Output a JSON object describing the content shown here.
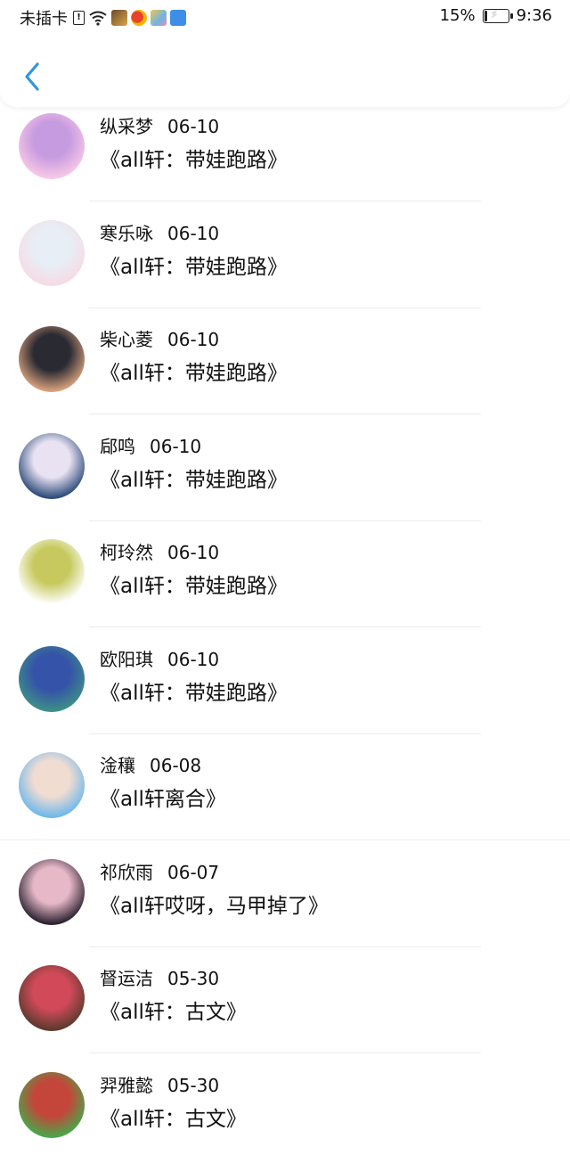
{
  "status_bar": {
    "carrier": "未插卡",
    "sim_badge": "!",
    "battery": "15%",
    "battery_level": 0.15,
    "time": "9:36",
    "icons": [
      "sim-alert-icon",
      "wifi-icon",
      "app-notification-icon",
      "weibo-icon",
      "app-notification-icon",
      "cloud-icon",
      "battery-charging-icon"
    ]
  },
  "header": {
    "back_icon": "chevron-left-icon",
    "accent": "#2f97d8"
  },
  "items": [
    {
      "name": "纵采梦",
      "date": "06-10",
      "title": "《all轩：带娃跑路》",
      "avatar_colors": [
        "#f7c8e6",
        "#c79be0"
      ]
    },
    {
      "name": "寒乐咏",
      "date": "06-10",
      "title": "《all轩：带娃跑路》",
      "avatar_colors": [
        "#f6dbe4",
        "#e7eef6"
      ]
    },
    {
      "name": "柴心菱",
      "date": "06-10",
      "title": "《all轩：带娃跑路》",
      "avatar_colors": [
        "#d9a27e",
        "#2a2a33"
      ]
    },
    {
      "name": "郈鸣",
      "date": "06-10",
      "title": "《all轩：带娃跑路》",
      "avatar_colors": [
        "#2b4a7a",
        "#e9e2f2"
      ]
    },
    {
      "name": "柯玲然",
      "date": "06-10",
      "title": "《all轩：带娃跑路》",
      "avatar_colors": [
        "#ffffff",
        "#c7c95e"
      ]
    },
    {
      "name": "欧阳琪",
      "date": "06-10",
      "title": "《all轩：带娃跑路》",
      "avatar_colors": [
        "#3d8f88",
        "#3553a8"
      ]
    },
    {
      "name": "淦穰",
      "date": "06-08",
      "title": "《all轩离合》",
      "avatar_colors": [
        "#6fb8ea",
        "#f1dcd2"
      ]
    },
    {
      "name": "祁欣雨",
      "date": "06-07",
      "title": "《all轩哎呀，马甲掉了》",
      "avatar_colors": [
        "#2a2230",
        "#e7b8c8"
      ]
    },
    {
      "name": "督运洁",
      "date": "05-30",
      "title": "《all轩：古文》",
      "avatar_colors": [
        "#5c3a2e",
        "#d24a5a"
      ]
    },
    {
      "name": "羿雅懿",
      "date": "05-30",
      "title": "《all轩：古文》",
      "avatar_colors": [
        "#47a84a",
        "#c4463a"
      ]
    }
  ]
}
